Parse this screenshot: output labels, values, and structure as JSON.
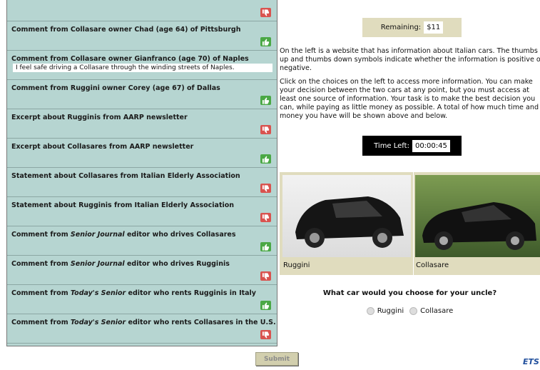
{
  "comments": [
    {
      "title": "",
      "thumb": "down"
    },
    {
      "title": "Comment from Collasare owner Chad (age 64) of Pittsburgh",
      "thumb": "up"
    },
    {
      "title": "Comment from Collasare owner Gianfranco (age 70) of Naples",
      "quote": "I feel safe driving a Collasare through the winding streets of Naples."
    },
    {
      "title": "Comment from Ruggini owner Corey (age 67) of Dallas",
      "thumb": "up"
    },
    {
      "title": "Excerpt about Rugginis from AARP newsletter",
      "thumb": "down"
    },
    {
      "title": "Excerpt about Collasares from AARP newsletter",
      "thumb": "up"
    },
    {
      "title": "Statement about Collasares from Italian Elderly Association",
      "thumb": "down"
    },
    {
      "title": "Statement about Rugginis from Italian Elderly Association",
      "thumb": "down"
    },
    {
      "title_pre": "Comment from ",
      "title_em": "Senior Journal",
      "title_post": " editor who drives Collasares",
      "thumb": "up"
    },
    {
      "title_pre": "Comment from ",
      "title_em": "Senior Journal",
      "title_post": " editor who drives Rugginis",
      "thumb": "down"
    },
    {
      "title_pre": "Comment from ",
      "title_em": "Today's Senior",
      "title_post": " editor who rents Rugginis in Italy",
      "thumb": "up"
    },
    {
      "title_pre": "Comment from ",
      "title_em": "Today's Senior",
      "title_post": " editor who rents Collasares in the U.S.",
      "thumb": "down"
    }
  ],
  "remaining": {
    "label": "Remaining:",
    "value": "$11"
  },
  "instructions": {
    "p1": [
      "On the left is a website that has information about Italian cars. The thumbs",
      "up and thumbs down symbols indicate whether the information is positive o",
      "negative."
    ],
    "p2": [
      "Click on the choices on the left to access more information. You can make",
      "your decision between the two cars at any point, but you must access at",
      "least one source of information. Your task is to make the best decision you",
      "can, while paying as little money as possible. A total of how much time and",
      "money you have will be shown above and below."
    ]
  },
  "timer": {
    "label": "Time Left:",
    "value": "00:00:45"
  },
  "cars": [
    {
      "name": "Ruggini"
    },
    {
      "name": "Collasare"
    }
  ],
  "question": "What car would you choose for your uncle?",
  "options": [
    "Ruggini",
    "Collasare"
  ],
  "submit_label": "Submit",
  "logo_text": "ETS",
  "colors": {
    "panel": "#b6d5d1",
    "thumb_up": "#4aa845",
    "thumb_down": "#d9534f",
    "beige": "#e0dcbe"
  }
}
